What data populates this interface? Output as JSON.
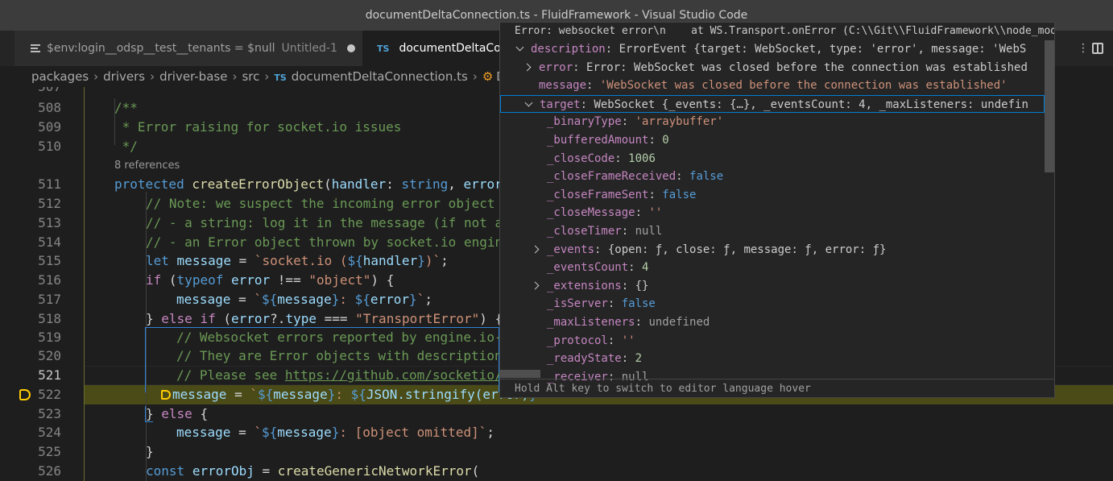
{
  "window": {
    "title": "documentDeltaConnection.ts - FluidFramework - Visual Studio Code"
  },
  "tabs": [
    {
      "label": "$env:login__odsp__test__tenants = $null",
      "extra": "Untitled-1",
      "icon": "lines-icon"
    },
    {
      "label": "documentDeltaCo",
      "badge": "TS"
    }
  ],
  "breadcrumb": {
    "items": [
      "packages",
      "drivers",
      "driver-base",
      "src",
      "documentDeltaConnection.ts"
    ],
    "ts_badge": "TS",
    "symbol_tail": "D"
  },
  "editor": {
    "partial_line": "507",
    "codelens": "8 references",
    "lines": [
      {
        "n": "508",
        "text": "/**"
      },
      {
        "n": "509",
        "text": " * Error raising for socket.io issues"
      },
      {
        "n": "510",
        "text": " */"
      },
      {
        "n": "511",
        "text": "protected createErrorObject(handler: string, error"
      },
      {
        "n": "512",
        "text": "// Note: we suspect the incoming error object"
      },
      {
        "n": "513",
        "text": "// - a string: log it in the message (if not a"
      },
      {
        "n": "514",
        "text": "// - an Error object thrown by socket.io engin"
      },
      {
        "n": "515",
        "text": "let message = `socket.io (${handler})`;"
      },
      {
        "n": "516",
        "text": "if (typeof error !== \"object\") {"
      },
      {
        "n": "517",
        "text": "message = `${message}: ${error}`;"
      },
      {
        "n": "518",
        "text": "} else if (error?.type === \"TransportError\") {"
      },
      {
        "n": "519",
        "text": "// Websocket errors reported by engine.io-"
      },
      {
        "n": "520",
        "text": "// They are Error objects with description"
      },
      {
        "n": "521",
        "text": "// Please see https://github.com/socketio/"
      },
      {
        "n": "522",
        "text": "message = `${message}: ${JSON.stringify(error)}`"
      },
      {
        "n": "523",
        "text": "} else {"
      },
      {
        "n": "524",
        "text": "message = `${message}: [object omitted]`;"
      },
      {
        "n": "525",
        "text": "}"
      },
      {
        "n": "526",
        "text": "const errorObj = createGenericNetworkError("
      }
    ]
  },
  "hover": {
    "header": "Error: websocket error\\n    at WS.Transport.onError (C:\\\\Git\\\\FluidFramework\\\\node_modu",
    "rows": [
      {
        "indent": 0,
        "chevron": "down",
        "key": "description",
        "value": "ErrorEvent {target: WebSocket, type: 'error', message: 'WebS",
        "kind": "gray"
      },
      {
        "indent": 1,
        "chevron": "right",
        "key": "error",
        "value": "Error: WebSocket was closed before the connection was established",
        "kind": "gray"
      },
      {
        "indent": 1,
        "chevron": "",
        "key": "message",
        "value": "'WebSocket was closed before the connection was established'",
        "kind": "str"
      },
      {
        "indent": 1,
        "chevron": "down",
        "key": "target",
        "value": "WebSocket {_events: {…}, _eventsCount: 4, _maxListeners: undefin",
        "kind": "gray",
        "selected": true
      },
      {
        "indent": 2,
        "chevron": "",
        "key": "_binaryType",
        "value": "'arraybuffer'",
        "kind": "str"
      },
      {
        "indent": 2,
        "chevron": "",
        "key": "_bufferedAmount",
        "value": "0",
        "kind": "num"
      },
      {
        "indent": 2,
        "chevron": "",
        "key": "_closeCode",
        "value": "1006",
        "kind": "num"
      },
      {
        "indent": 2,
        "chevron": "",
        "key": "_closeFrameReceived",
        "value": "false",
        "kind": "bool"
      },
      {
        "indent": 2,
        "chevron": "",
        "key": "_closeFrameSent",
        "value": "false",
        "kind": "bool"
      },
      {
        "indent": 2,
        "chevron": "",
        "key": "_closeMessage",
        "value": "''",
        "kind": "str"
      },
      {
        "indent": 2,
        "chevron": "",
        "key": "_closeTimer",
        "value": "null",
        "kind": "null"
      },
      {
        "indent": 2,
        "chevron": "right",
        "key": "_events",
        "value": "{open: ƒ, close: ƒ, message: ƒ, error: ƒ}",
        "kind": "gray"
      },
      {
        "indent": 2,
        "chevron": "",
        "key": "_eventsCount",
        "value": "4",
        "kind": "num"
      },
      {
        "indent": 2,
        "chevron": "right",
        "key": "_extensions",
        "value": "{}",
        "kind": "gray"
      },
      {
        "indent": 2,
        "chevron": "",
        "key": "_isServer",
        "value": "false",
        "kind": "bool"
      },
      {
        "indent": 2,
        "chevron": "",
        "key": "_maxListeners",
        "value": "undefined",
        "kind": "null"
      },
      {
        "indent": 2,
        "chevron": "",
        "key": "_protocol",
        "value": "''",
        "kind": "str"
      },
      {
        "indent": 2,
        "chevron": "",
        "key": "_readyState",
        "value": "2",
        "kind": "num"
      },
      {
        "indent": 2,
        "chevron": "",
        "key": "_receiver",
        "value": "null",
        "kind": "null"
      }
    ],
    "footer": "Hold Alt key to switch to editor language hover"
  },
  "colors": {
    "breakpoint": "#ffcc00",
    "current_line": "#4b4b18",
    "accent": "#007fd4"
  }
}
